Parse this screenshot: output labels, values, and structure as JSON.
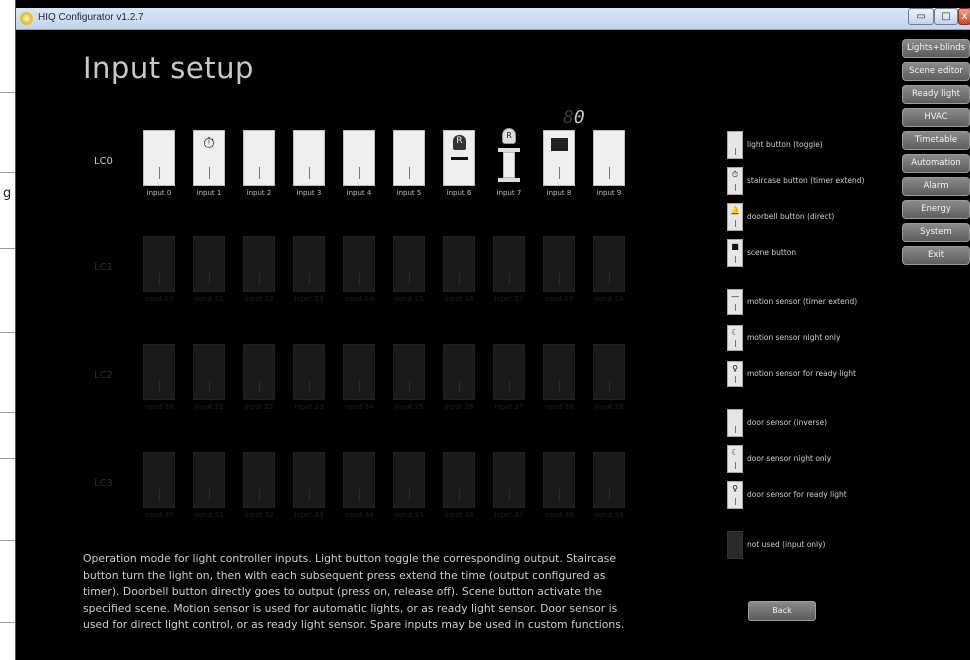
{
  "window": {
    "title": "HIQ Configurator v1.2.7",
    "min_glyph": "▭",
    "max_glyph": "□",
    "close_glyph": "x"
  },
  "background_glyph": "g",
  "page_title": "Input setup",
  "counter": {
    "faint": "8",
    "value": "0"
  },
  "rows": [
    {
      "label": "LC0",
      "active": true,
      "inputs": [
        {
          "label": "input 0",
          "type": "light"
        },
        {
          "label": "input 1",
          "type": "staircase"
        },
        {
          "label": "input 2",
          "type": "light"
        },
        {
          "label": "input 3",
          "type": "light"
        },
        {
          "label": "input 4",
          "type": "light"
        },
        {
          "label": "input 5",
          "type": "light"
        },
        {
          "label": "input 6",
          "type": "motion-ready"
        },
        {
          "label": "input 7",
          "type": "door-ready"
        },
        {
          "label": "input 8",
          "type": "scene"
        },
        {
          "label": "input 9",
          "type": "light"
        }
      ]
    },
    {
      "label": "LC1",
      "active": false,
      "inputs": [
        {
          "label": "input 10"
        },
        {
          "label": "input 11"
        },
        {
          "label": "input 12"
        },
        {
          "label": "input 13"
        },
        {
          "label": "input 14"
        },
        {
          "label": "input 15"
        },
        {
          "label": "input 16"
        },
        {
          "label": "input 17"
        },
        {
          "label": "input 18"
        },
        {
          "label": "input 19"
        }
      ]
    },
    {
      "label": "LC2",
      "active": false,
      "inputs": [
        {
          "label": "input 20"
        },
        {
          "label": "input 21"
        },
        {
          "label": "input 22"
        },
        {
          "label": "input 23"
        },
        {
          "label": "input 24"
        },
        {
          "label": "input 25"
        },
        {
          "label": "input 26"
        },
        {
          "label": "input 27"
        },
        {
          "label": "input 28"
        },
        {
          "label": "input 29"
        }
      ]
    },
    {
      "label": "LC3",
      "active": false,
      "inputs": [
        {
          "label": "input 30"
        },
        {
          "label": "input 31"
        },
        {
          "label": "input 32"
        },
        {
          "label": "input 33"
        },
        {
          "label": "input 34"
        },
        {
          "label": "input 35"
        },
        {
          "label": "input 36"
        },
        {
          "label": "input 37"
        },
        {
          "label": "input 38"
        },
        {
          "label": "input 39"
        }
      ]
    }
  ],
  "legend": [
    {
      "label": "light button (toggle)",
      "icon": "light-button-icon",
      "mark": ""
    },
    {
      "label": "staircase button (timer extend)",
      "icon": "timer-icon",
      "mark": "⏱"
    },
    {
      "label": "doorbell button (direct)",
      "icon": "bell-icon",
      "mark": "🔔"
    },
    {
      "label": "scene button",
      "icon": "scene-icon",
      "mark": "■"
    },
    {
      "label": "motion sensor (timer extend)",
      "icon": "motion-sensor-icon",
      "mark": "—"
    },
    {
      "label": "motion sensor night only",
      "icon": "moon-icon",
      "mark": "☾"
    },
    {
      "label": "motion sensor for ready light",
      "icon": "ready-light-icon",
      "mark": "♀"
    },
    {
      "label": "door sensor (inverse)",
      "icon": "door-sensor-icon",
      "mark": ""
    },
    {
      "label": "door sensor night only",
      "icon": "door-moon-icon",
      "mark": "☾"
    },
    {
      "label": "door sensor for ready light",
      "icon": "door-ready-icon",
      "mark": "♀"
    },
    {
      "label": "not used (input only)",
      "icon": "not-used-icon",
      "mark": ""
    }
  ],
  "nav": [
    "Lights+blinds",
    "Scene editor",
    "Ready light",
    "HVAC",
    "Timetable",
    "Automation",
    "Alarm",
    "Energy",
    "System",
    "Exit"
  ],
  "description": "Operation mode for light controller inputs. Light button toggle the corresponding output. Staircase button turn the light on, then with each subsequent press extend the time (output configured as timer). Doorbell button directly goes to output (press on, release off). Scene button activate the specified scene. Motion sensor is used for automatic lights, or as ready light sensor. Door sensor is used for direct light control, or as ready light sensor. Spare inputs may be used in custom functions.",
  "back_button": "Back"
}
